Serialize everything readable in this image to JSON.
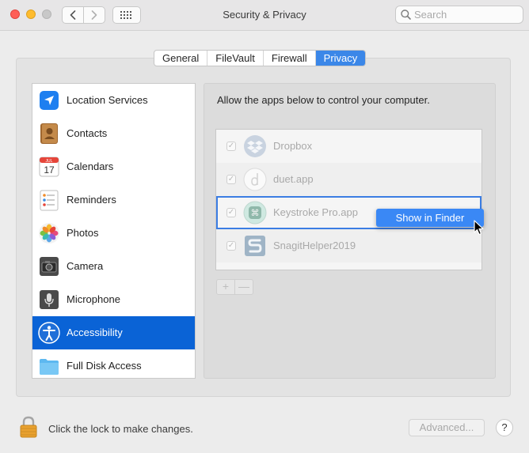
{
  "window": {
    "title": "Security & Privacy"
  },
  "search": {
    "placeholder": "Search"
  },
  "tabs": [
    {
      "label": "General"
    },
    {
      "label": "FileVault"
    },
    {
      "label": "Firewall"
    },
    {
      "label": "Privacy",
      "active": true
    }
  ],
  "sidebar": {
    "items": [
      {
        "label": "Location Services",
        "icon": "location-arrow-icon"
      },
      {
        "label": "Contacts",
        "icon": "contacts-book-icon"
      },
      {
        "label": "Calendars",
        "icon": "calendar-icon",
        "calendar_month": "JUL",
        "calendar_day": "17"
      },
      {
        "label": "Reminders",
        "icon": "reminders-list-icon"
      },
      {
        "label": "Photos",
        "icon": "photos-flower-icon"
      },
      {
        "label": "Camera",
        "icon": "camera-icon"
      },
      {
        "label": "Microphone",
        "icon": "microphone-icon"
      },
      {
        "label": "Accessibility",
        "icon": "accessibility-icon",
        "selected": true
      },
      {
        "label": "Full Disk Access",
        "icon": "folder-icon"
      }
    ]
  },
  "main": {
    "description": "Allow the apps below to control your computer.",
    "apps": [
      {
        "name": "Dropbox",
        "checked": true,
        "icon": "dropbox-icon"
      },
      {
        "name": "duet.app",
        "checked": true,
        "icon": "duet-icon"
      },
      {
        "name": "Keystroke Pro.app",
        "checked": true,
        "icon": "keystroke-pro-icon",
        "selected": true
      },
      {
        "name": "SnagitHelper2019",
        "checked": true,
        "icon": "snagit-icon"
      }
    ],
    "add_symbol": "+",
    "remove_symbol": "—"
  },
  "context_menu": {
    "item": "Show in Finder"
  },
  "footer": {
    "lock_text": "Click the lock to make changes.",
    "advanced_label": "Advanced...",
    "help_label": "?"
  },
  "colors": {
    "accent": "#0a63d6",
    "tab_active": "#3b87e8",
    "menu_highlight": "#3a88f5"
  }
}
